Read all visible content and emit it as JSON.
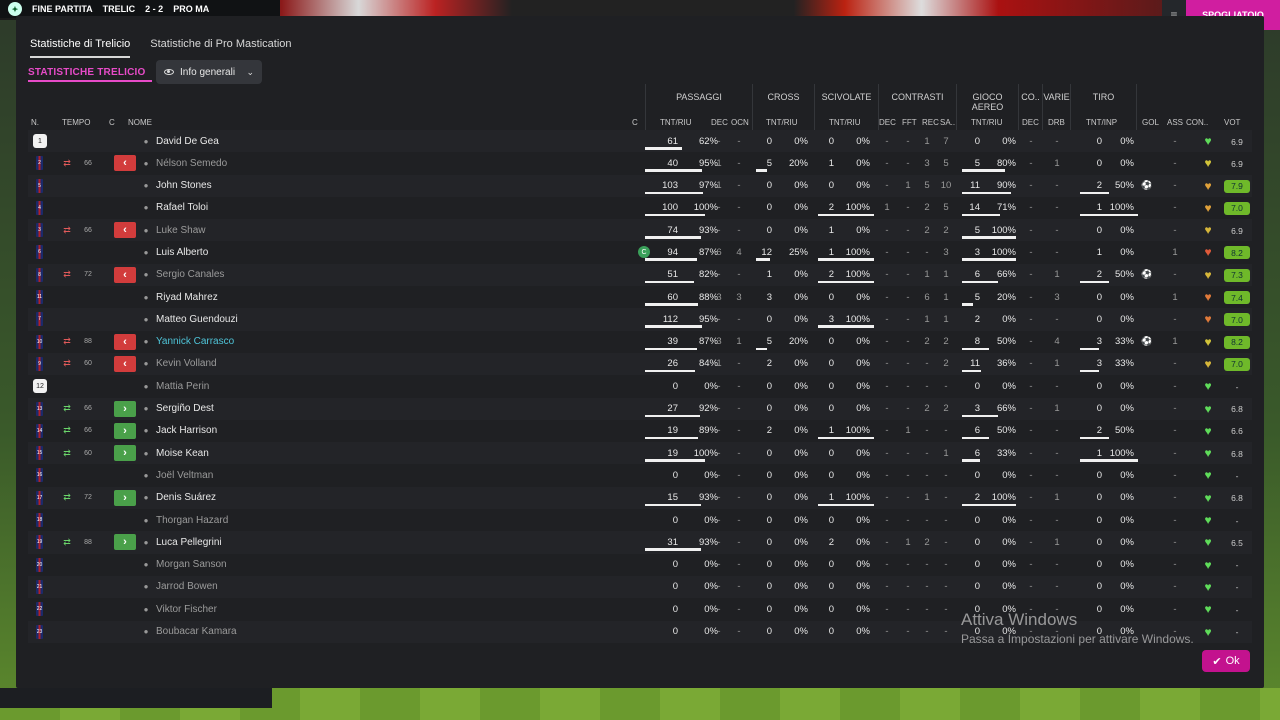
{
  "background": {
    "score_label": "FINE PARTITA",
    "home_team": "TRELIC",
    "score": "2 - 2",
    "away_team": "PRO MA",
    "right_button": "SPOGLIATOIO"
  },
  "tabs": [
    {
      "label": "Statistiche di Trelicio",
      "active": true
    },
    {
      "label": "Statistiche di Pro Mastication",
      "active": false
    }
  ],
  "section_title": "STATISTICHE TRELICIO",
  "dropdown": {
    "label": "Info generali"
  },
  "groups": [
    "PASSAGGI",
    "CROSS",
    "SCIVOLATE",
    "CONTRASTI",
    "GIOCO AEREO",
    "CO..",
    "VARIE",
    "TIRO"
  ],
  "headers": {
    "n": "N.",
    "tempo": "TEMPO",
    "c": "C",
    "nome": "NOME",
    "cap": "C",
    "pass": "TNT/RIU",
    "pass_dec": "DEC",
    "pass_ocn": "OCN",
    "cross": "TNT/RIU",
    "tackle": "TNT/RIU",
    "con_dec": "DEC",
    "con_fft": "FFT",
    "con_rec": "REC",
    "con_sa": "SA..",
    "aerial": "TNT/RIU",
    "co_dec": "DEC",
    "drb": "DRB",
    "shots": "TNT/INP",
    "gol": "GOL",
    "ass": "ASS",
    "con": "CON..",
    "vot": "VOT"
  },
  "players": [
    {
      "num": "1",
      "gk": true,
      "sub": "",
      "min": "",
      "name": "David De Gea",
      "style": "",
      "cap": "",
      "p": "61",
      "pp": "62%",
      "pb": 62,
      "pdec": "-",
      "pocn": "-",
      "c": "0",
      "cp": "0%",
      "cb": 0,
      "t": "0",
      "tp": "0%",
      "tb": 0,
      "cdec": "-",
      "fft": "-",
      "rec": "1",
      "sa": "7",
      "a": "0",
      "ap": "0%",
      "ab": 0,
      "codec": "-",
      "drb": "-",
      "s": "0",
      "sp": "0%",
      "sb": 0,
      "gol": "",
      "ass": "-",
      "heart": "#5fdc5a",
      "vot": "6.9",
      "good": false
    },
    {
      "num": "2",
      "gk": false,
      "sub": "out",
      "min": "66",
      "name": "Nélson Semedo",
      "style": "dim",
      "cap": "",
      "p": "40",
      "pp": "95%",
      "pb": 95,
      "pdec": "1",
      "pocn": "-",
      "c": "5",
      "cp": "20%",
      "cb": 20,
      "t": "1",
      "tp": "0%",
      "tb": 0,
      "cdec": "-",
      "fft": "-",
      "rec": "3",
      "sa": "5",
      "a": "5",
      "ap": "80%",
      "ab": 80,
      "codec": "-",
      "drb": "1",
      "s": "0",
      "sp": "0%",
      "sb": 0,
      "gol": "",
      "ass": "-",
      "heart": "#d2c43a",
      "vot": "6.9",
      "good": false
    },
    {
      "num": "5",
      "gk": false,
      "sub": "",
      "min": "",
      "name": "John Stones",
      "style": "",
      "cap": "",
      "p": "103",
      "pp": "97%",
      "pb": 97,
      "pdec": "1",
      "pocn": "-",
      "c": "0",
      "cp": "0%",
      "cb": 0,
      "t": "0",
      "tp": "0%",
      "tb": 0,
      "cdec": "-",
      "fft": "1",
      "rec": "5",
      "sa": "10",
      "a": "11",
      "ap": "90%",
      "ab": 90,
      "codec": "-",
      "drb": "-",
      "s": "2",
      "sp": "50%",
      "sb": 50,
      "gol": "⚽",
      "ass": "-",
      "heart": "#e0a13a",
      "vot": "7.9",
      "good": true
    },
    {
      "num": "4",
      "gk": false,
      "sub": "",
      "min": "",
      "name": "Rafael Toloi",
      "style": "",
      "cap": "",
      "p": "100",
      "pp": "100%",
      "pb": 100,
      "pdec": "-",
      "pocn": "-",
      "c": "0",
      "cp": "0%",
      "cb": 0,
      "t": "2",
      "tp": "100%",
      "tb": 100,
      "cdec": "1",
      "fft": "-",
      "rec": "2",
      "sa": "5",
      "a": "14",
      "ap": "71%",
      "ab": 71,
      "codec": "-",
      "drb": "-",
      "s": "1",
      "sp": "100%",
      "sb": 100,
      "gol": "",
      "ass": "-",
      "heart": "#e0a13a",
      "vot": "7.0",
      "good": true
    },
    {
      "num": "3",
      "gk": false,
      "sub": "out",
      "min": "66",
      "name": "Luke Shaw",
      "style": "dim",
      "cap": "",
      "p": "74",
      "pp": "93%",
      "pb": 93,
      "pdec": "-",
      "pocn": "-",
      "c": "0",
      "cp": "0%",
      "cb": 0,
      "t": "1",
      "tp": "0%",
      "tb": 0,
      "cdec": "-",
      "fft": "-",
      "rec": "2",
      "sa": "2",
      "a": "5",
      "ap": "100%",
      "ab": 100,
      "codec": "-",
      "drb": "-",
      "s": "0",
      "sp": "0%",
      "sb": 0,
      "gol": "",
      "ass": "-",
      "heart": "#d6b63a",
      "vot": "6.9",
      "good": false
    },
    {
      "num": "6",
      "gk": false,
      "sub": "",
      "min": "",
      "name": "Luis Alberto",
      "style": "",
      "cap": "C",
      "p": "94",
      "pp": "87%",
      "pb": 87,
      "pdec": "6",
      "pocn": "4",
      "c": "12",
      "cp": "25%",
      "cb": 25,
      "t": "1",
      "tp": "100%",
      "tb": 100,
      "cdec": "-",
      "fft": "-",
      "rec": "-",
      "sa": "3",
      "a": "3",
      "ap": "100%",
      "ab": 100,
      "codec": "-",
      "drb": "-",
      "s": "1",
      "sp": "0%",
      "sb": 0,
      "gol": "",
      "ass": "1",
      "heart": "#e05a3a",
      "vot": "8.2",
      "good": true
    },
    {
      "num": "8",
      "gk": false,
      "sub": "out",
      "min": "72",
      "name": "Sergio Canales",
      "style": "dim",
      "cap": "",
      "p": "51",
      "pp": "82%",
      "pb": 82,
      "pdec": "-",
      "pocn": "-",
      "c": "1",
      "cp": "0%",
      "cb": 0,
      "t": "2",
      "tp": "100%",
      "tb": 100,
      "cdec": "-",
      "fft": "-",
      "rec": "1",
      "sa": "1",
      "a": "6",
      "ap": "66%",
      "ab": 66,
      "codec": "-",
      "drb": "1",
      "s": "2",
      "sp": "50%",
      "sb": 50,
      "gol": "⚽",
      "ass": "-",
      "heart": "#d6b63a",
      "vot": "7.3",
      "good": true
    },
    {
      "num": "11",
      "gk": false,
      "sub": "",
      "min": "",
      "name": "Riyad Mahrez",
      "style": "",
      "cap": "",
      "p": "60",
      "pp": "88%",
      "pb": 88,
      "pdec": "3",
      "pocn": "3",
      "c": "3",
      "cp": "0%",
      "cb": 0,
      "t": "0",
      "tp": "0%",
      "tb": 0,
      "cdec": "-",
      "fft": "-",
      "rec": "6",
      "sa": "1",
      "a": "5",
      "ap": "20%",
      "ab": 20,
      "codec": "-",
      "drb": "3",
      "s": "0",
      "sp": "0%",
      "sb": 0,
      "gol": "",
      "ass": "1",
      "heart": "#e07a3a",
      "vot": "7.4",
      "good": true
    },
    {
      "num": "7",
      "gk": false,
      "sub": "",
      "min": "",
      "name": "Matteo Guendouzi",
      "style": "",
      "cap": "",
      "p": "112",
      "pp": "95%",
      "pb": 95,
      "pdec": "-",
      "pocn": "-",
      "c": "0",
      "cp": "0%",
      "cb": 0,
      "t": "3",
      "tp": "100%",
      "tb": 100,
      "cdec": "-",
      "fft": "-",
      "rec": "1",
      "sa": "1",
      "a": "2",
      "ap": "0%",
      "ab": 0,
      "codec": "-",
      "drb": "-",
      "s": "0",
      "sp": "0%",
      "sb": 0,
      "gol": "",
      "ass": "-",
      "heart": "#e07a3a",
      "vot": "7.0",
      "good": true
    },
    {
      "num": "10",
      "gk": false,
      "sub": "out",
      "min": "88",
      "name": "Yannick Carrasco",
      "style": "hl",
      "cap": "",
      "p": "39",
      "pp": "87%",
      "pb": 87,
      "pdec": "3",
      "pocn": "1",
      "c": "5",
      "cp": "20%",
      "cb": 20,
      "t": "0",
      "tp": "0%",
      "tb": 0,
      "cdec": "-",
      "fft": "-",
      "rec": "2",
      "sa": "2",
      "a": "8",
      "ap": "50%",
      "ab": 50,
      "codec": "-",
      "drb": "4",
      "s": "3",
      "sp": "33%",
      "sb": 33,
      "gol": "⚽",
      "ass": "1",
      "heart": "#d2c43a",
      "vot": "8.2",
      "good": true
    },
    {
      "num": "9",
      "gk": false,
      "sub": "out",
      "min": "60",
      "name": "Kevin Volland",
      "style": "dim",
      "cap": "",
      "p": "26",
      "pp": "84%",
      "pb": 84,
      "pdec": "1",
      "pocn": "-",
      "c": "2",
      "cp": "0%",
      "cb": 0,
      "t": "0",
      "tp": "0%",
      "tb": 0,
      "cdec": "-",
      "fft": "-",
      "rec": "-",
      "sa": "2",
      "a": "11",
      "ap": "36%",
      "ab": 36,
      "codec": "-",
      "drb": "1",
      "s": "3",
      "sp": "33%",
      "sb": 33,
      "gol": "",
      "ass": "-",
      "heart": "#d6b63a",
      "vot": "7.0",
      "good": true
    },
    {
      "num": "12",
      "gk": true,
      "sub": "",
      "min": "",
      "name": "Mattia Perin",
      "style": "dim",
      "cap": "",
      "p": "0",
      "pp": "0%",
      "pb": 0,
      "pdec": "-",
      "pocn": "-",
      "c": "0",
      "cp": "0%",
      "cb": 0,
      "t": "0",
      "tp": "0%",
      "tb": 0,
      "cdec": "-",
      "fft": "-",
      "rec": "-",
      "sa": "-",
      "a": "0",
      "ap": "0%",
      "ab": 0,
      "codec": "-",
      "drb": "-",
      "s": "0",
      "sp": "0%",
      "sb": 0,
      "gol": "",
      "ass": "-",
      "heart": "#5fdc5a",
      "vot": "-",
      "good": false
    },
    {
      "num": "13",
      "gk": false,
      "sub": "in",
      "min": "66",
      "name": "Sergiño Dest",
      "style": "",
      "cap": "",
      "p": "27",
      "pp": "92%",
      "pb": 92,
      "pdec": "-",
      "pocn": "-",
      "c": "0",
      "cp": "0%",
      "cb": 0,
      "t": "0",
      "tp": "0%",
      "tb": 0,
      "cdec": "-",
      "fft": "-",
      "rec": "2",
      "sa": "2",
      "a": "3",
      "ap": "66%",
      "ab": 66,
      "codec": "-",
      "drb": "1",
      "s": "0",
      "sp": "0%",
      "sb": 0,
      "gol": "",
      "ass": "-",
      "heart": "#5fdc5a",
      "vot": "6.8",
      "good": false
    },
    {
      "num": "14",
      "gk": false,
      "sub": "in",
      "min": "66",
      "name": "Jack Harrison",
      "style": "",
      "cap": "",
      "p": "19",
      "pp": "89%",
      "pb": 89,
      "pdec": "-",
      "pocn": "-",
      "c": "2",
      "cp": "0%",
      "cb": 0,
      "t": "1",
      "tp": "100%",
      "tb": 100,
      "cdec": "-",
      "fft": "1",
      "rec": "-",
      "sa": "-",
      "a": "6",
      "ap": "50%",
      "ab": 50,
      "codec": "-",
      "drb": "-",
      "s": "2",
      "sp": "50%",
      "sb": 50,
      "gol": "",
      "ass": "-",
      "heart": "#5fdc5a",
      "vot": "6.6",
      "good": false
    },
    {
      "num": "15",
      "gk": false,
      "sub": "in",
      "min": "60",
      "name": "Moise Kean",
      "style": "",
      "cap": "",
      "p": "19",
      "pp": "100%",
      "pb": 100,
      "pdec": "-",
      "pocn": "-",
      "c": "0",
      "cp": "0%",
      "cb": 0,
      "t": "0",
      "tp": "0%",
      "tb": 0,
      "cdec": "-",
      "fft": "-",
      "rec": "-",
      "sa": "1",
      "a": "6",
      "ap": "33%",
      "ab": 33,
      "codec": "-",
      "drb": "-",
      "s": "1",
      "sp": "100%",
      "sb": 100,
      "gol": "",
      "ass": "-",
      "heart": "#5fdc5a",
      "vot": "6.8",
      "good": false
    },
    {
      "num": "16",
      "gk": false,
      "sub": "",
      "min": "",
      "name": "Joël Veltman",
      "style": "dim",
      "cap": "",
      "p": "0",
      "pp": "0%",
      "pb": 0,
      "pdec": "-",
      "pocn": "-",
      "c": "0",
      "cp": "0%",
      "cb": 0,
      "t": "0",
      "tp": "0%",
      "tb": 0,
      "cdec": "-",
      "fft": "-",
      "rec": "-",
      "sa": "-",
      "a": "0",
      "ap": "0%",
      "ab": 0,
      "codec": "-",
      "drb": "-",
      "s": "0",
      "sp": "0%",
      "sb": 0,
      "gol": "",
      "ass": "-",
      "heart": "#5fdc5a",
      "vot": "-",
      "good": false
    },
    {
      "num": "17",
      "gk": false,
      "sub": "in",
      "min": "72",
      "name": "Denis Suárez",
      "style": "",
      "cap": "",
      "p": "15",
      "pp": "93%",
      "pb": 93,
      "pdec": "-",
      "pocn": "-",
      "c": "0",
      "cp": "0%",
      "cb": 0,
      "t": "1",
      "tp": "100%",
      "tb": 100,
      "cdec": "-",
      "fft": "-",
      "rec": "1",
      "sa": "-",
      "a": "2",
      "ap": "100%",
      "ab": 100,
      "codec": "-",
      "drb": "1",
      "s": "0",
      "sp": "0%",
      "sb": 0,
      "gol": "",
      "ass": "-",
      "heart": "#5fdc5a",
      "vot": "6.8",
      "good": false
    },
    {
      "num": "18",
      "gk": false,
      "sub": "",
      "min": "",
      "name": "Thorgan Hazard",
      "style": "dim",
      "cap": "",
      "p": "0",
      "pp": "0%",
      "pb": 0,
      "pdec": "-",
      "pocn": "-",
      "c": "0",
      "cp": "0%",
      "cb": 0,
      "t": "0",
      "tp": "0%",
      "tb": 0,
      "cdec": "-",
      "fft": "-",
      "rec": "-",
      "sa": "-",
      "a": "0",
      "ap": "0%",
      "ab": 0,
      "codec": "-",
      "drb": "-",
      "s": "0",
      "sp": "0%",
      "sb": 0,
      "gol": "",
      "ass": "-",
      "heart": "#5fdc5a",
      "vot": "-",
      "good": false
    },
    {
      "num": "19",
      "gk": false,
      "sub": "in",
      "min": "88",
      "name": "Luca Pellegrini",
      "style": "",
      "cap": "",
      "p": "31",
      "pp": "93%",
      "pb": 93,
      "pdec": "-",
      "pocn": "-",
      "c": "0",
      "cp": "0%",
      "cb": 0,
      "t": "2",
      "tp": "0%",
      "tb": 0,
      "cdec": "-",
      "fft": "1",
      "rec": "2",
      "sa": "-",
      "a": "0",
      "ap": "0%",
      "ab": 0,
      "codec": "-",
      "drb": "1",
      "s": "0",
      "sp": "0%",
      "sb": 0,
      "gol": "",
      "ass": "-",
      "heart": "#5fdc5a",
      "vot": "6.5",
      "good": false
    },
    {
      "num": "20",
      "gk": false,
      "sub": "",
      "min": "",
      "name": "Morgan Sanson",
      "style": "dim",
      "cap": "",
      "p": "0",
      "pp": "0%",
      "pb": 0,
      "pdec": "-",
      "pocn": "-",
      "c": "0",
      "cp": "0%",
      "cb": 0,
      "t": "0",
      "tp": "0%",
      "tb": 0,
      "cdec": "-",
      "fft": "-",
      "rec": "-",
      "sa": "-",
      "a": "0",
      "ap": "0%",
      "ab": 0,
      "codec": "-",
      "drb": "-",
      "s": "0",
      "sp": "0%",
      "sb": 0,
      "gol": "",
      "ass": "-",
      "heart": "#5fdc5a",
      "vot": "-",
      "good": false
    },
    {
      "num": "21",
      "gk": false,
      "sub": "",
      "min": "",
      "name": "Jarrod Bowen",
      "style": "dim",
      "cap": "",
      "p": "0",
      "pp": "0%",
      "pb": 0,
      "pdec": "-",
      "pocn": "-",
      "c": "0",
      "cp": "0%",
      "cb": 0,
      "t": "0",
      "tp": "0%",
      "tb": 0,
      "cdec": "-",
      "fft": "-",
      "rec": "-",
      "sa": "-",
      "a": "0",
      "ap": "0%",
      "ab": 0,
      "codec": "-",
      "drb": "-",
      "s": "0",
      "sp": "0%",
      "sb": 0,
      "gol": "",
      "ass": "-",
      "heart": "#5fdc5a",
      "vot": "-",
      "good": false
    },
    {
      "num": "22",
      "gk": false,
      "sub": "",
      "min": "",
      "name": "Viktor Fischer",
      "style": "dim",
      "cap": "",
      "p": "0",
      "pp": "0%",
      "pb": 0,
      "pdec": "-",
      "pocn": "-",
      "c": "0",
      "cp": "0%",
      "cb": 0,
      "t": "0",
      "tp": "0%",
      "tb": 0,
      "cdec": "-",
      "fft": "-",
      "rec": "-",
      "sa": "-",
      "a": "0",
      "ap": "0%",
      "ab": 0,
      "codec": "-",
      "drb": "-",
      "s": "0",
      "sp": "0%",
      "sb": 0,
      "gol": "",
      "ass": "-",
      "heart": "#5fdc5a",
      "vot": "-",
      "good": false
    },
    {
      "num": "23",
      "gk": false,
      "sub": "",
      "min": "",
      "name": "Boubacar Kamara",
      "style": "dim",
      "cap": "",
      "p": "0",
      "pp": "0%",
      "pb": 0,
      "pdec": "-",
      "pocn": "-",
      "c": "0",
      "cp": "0%",
      "cb": 0,
      "t": "0",
      "tp": "0%",
      "tb": 0,
      "cdec": "-",
      "fft": "-",
      "rec": "-",
      "sa": "-",
      "a": "0",
      "ap": "0%",
      "ab": 0,
      "codec": "-",
      "drb": "-",
      "s": "0",
      "sp": "0%",
      "sb": 0,
      "gol": "",
      "ass": "-",
      "heart": "#5fdc5a",
      "vot": "-",
      "good": false
    }
  ],
  "ok_button": "Ok",
  "watermark": {
    "title": "Attiva Windows",
    "subtitle": "Passa a Impostazioni per attivare Windows."
  }
}
